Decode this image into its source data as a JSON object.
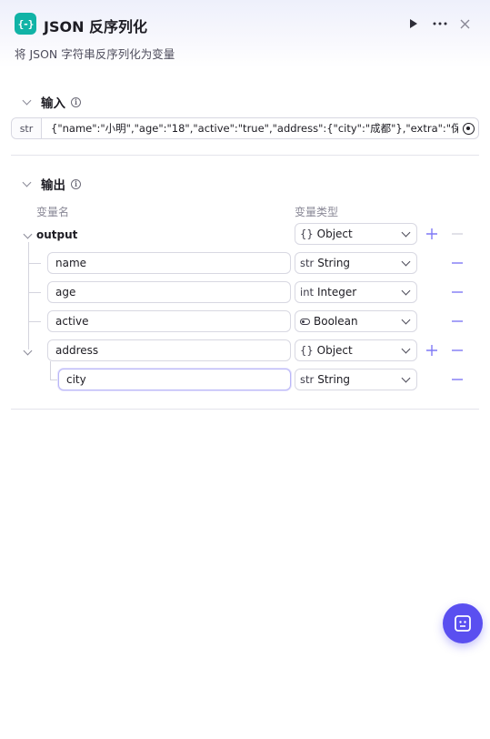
{
  "header": {
    "icon_text": "{-}",
    "title": "JSON 反序列化",
    "description": "将 JSON 字符串反序列化为变量"
  },
  "input_section": {
    "title": "输入",
    "type_tag": "str",
    "value": "{\"name\":\"小明\",\"age\":\"18\",\"active\":\"true\",\"address\":{\"city\":\"成都\"},\"extra\":\"保留\"}"
  },
  "output_section": {
    "title": "输出",
    "col_name": "变量名",
    "col_type": "变量类型",
    "root": {
      "name": "output",
      "type_icon": "{}",
      "type": "Object"
    },
    "fields": [
      {
        "name": "name",
        "type_icon": "str",
        "type": "String"
      },
      {
        "name": "age",
        "type_icon": "int",
        "type": "Integer"
      },
      {
        "name": "active",
        "type_icon": "toggle-icon",
        "type": "Boolean"
      },
      {
        "name": "address",
        "type_icon": "{}",
        "type": "Object"
      }
    ],
    "nested": [
      {
        "name": "city",
        "type_icon": "str",
        "type": "String"
      }
    ]
  },
  "colors": {
    "accent": "#5a4ff0",
    "node_icon": "#11b3a6",
    "action_icon": "#7f79f5"
  },
  "icons": {
    "run": "play-icon",
    "more": "more-icon",
    "close": "close-icon",
    "info": "info-icon",
    "reference": "reference-icon",
    "fab": "assistant-icon"
  }
}
